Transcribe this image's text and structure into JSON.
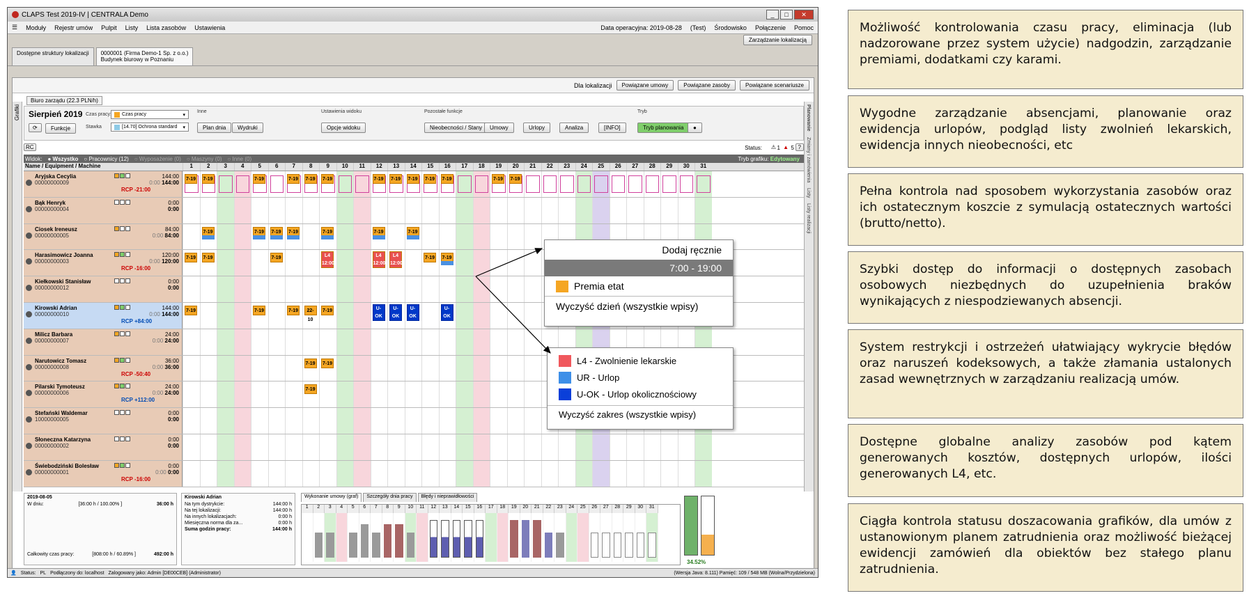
{
  "window": {
    "title": "CLAPS Test 2019-IV | CENTRALA Demo",
    "controls": [
      "_",
      "□",
      "✕"
    ]
  },
  "menu": {
    "items": [
      "Moduły",
      "Rejestr umów",
      "Pulpit",
      "Listy",
      "Lista zasobów",
      "Ustawienia"
    ],
    "date_label": "Data operacyjna: 2019-08-28",
    "env": "(Test)",
    "env2": "Środowisko",
    "conn": "Połączenie",
    "help": "Pomoc"
  },
  "tab_strip": {
    "label": "Zarządzanie lokalizacją"
  },
  "tabs": {
    "t1": "Dostępne struktury lokalizacji",
    "t2a": "0000001 (Firma Demo-1 Sp. z o.o.)",
    "t2b": "Budynek biurowy w Poznaniu"
  },
  "loc_bar": {
    "label": "Dla lokalizacji",
    "b1": "Powiązane umowy",
    "b2": "Powiązane zasoby",
    "b3": "Powiązane scenariusze"
  },
  "side": {
    "left": "Grafiki",
    "right1": "Planowanie",
    "right2": "Zmiany i zamówienia",
    "right3": "Listy",
    "right4": "Listy realizacji"
  },
  "subtab": "Biuro zarządu (22.3 PLN/h)",
  "tools": {
    "month": "Sierpień 2019",
    "czas_label": "Czas pracy:",
    "czas_value": "Czas pracy",
    "stawka_label": "Stawka",
    "stawka_value": "[14.70] Ochrona standard",
    "funkcje": "Funkcje",
    "inne": "Inne",
    "plan_dnia": "Plan dnia",
    "wydruki": "Wydruki",
    "ust_widoku": "Ustawienia widoku",
    "opcje_widoku": "Opcje widoku",
    "pozostale": "Pozostałe funkcje",
    "nieobecnosci": "Nieobecności / Stany",
    "umowy": "Umowy",
    "urlopy": "Urlopy",
    "analiza": "Analiza",
    "info": "[INFO]",
    "tryb": "Tryb",
    "tryb_btn": "Tryb planowania"
  },
  "status": {
    "label": "Status:",
    "warn_count": "1",
    "err_count": "5",
    "help": "?",
    "rc": "RC"
  },
  "view": {
    "label": "Widok:",
    "opts": [
      "Wszystko",
      "Pracownicy (12)",
      "Wyposażenie (0)",
      "Maszyny (0)",
      "Inne (0)"
    ],
    "mode": "Tryb grafiku:",
    "mode_val": "Edytowany"
  },
  "grid": {
    "col_header": "Name / Equipment / Machine",
    "days": [
      "1",
      "2",
      "3",
      "4",
      "5",
      "6",
      "7",
      "8",
      "9",
      "10",
      "11",
      "12",
      "13",
      "14",
      "15",
      "16",
      "17",
      "18",
      "19",
      "20",
      "21",
      "22",
      "23",
      "24",
      "25",
      "26",
      "27",
      "28",
      "29",
      "30",
      "31"
    ],
    "rows": [
      {
        "name": "Aryjska Cecylia",
        "id": "00000000009",
        "h1": "144:00",
        "h2g": "0:00",
        "h2": "144:00",
        "rcp": "RCP -21:00",
        "rcp_pos": false
      },
      {
        "name": "Bąk Henryk",
        "id": "00000000004",
        "h1": "0:00",
        "h2g": "",
        "h2": "0:00",
        "rcp": "",
        "rcp_pos": false
      },
      {
        "name": "Ciosek Ireneusz",
        "id": "00000000005",
        "h1": "84:00",
        "h2g": "0:00",
        "h2": "84:00",
        "rcp": "",
        "rcp_pos": false
      },
      {
        "name": "Harasimowicz Joanna",
        "id": "00000000003",
        "h1": "120:00",
        "h2g": "0:00",
        "h2": "120:00",
        "rcp": "RCP -16:00",
        "rcp_pos": false
      },
      {
        "name": "Kiełkowski Stanisław",
        "id": "00000000012",
        "h1": "0:00",
        "h2g": "",
        "h2": "0:00",
        "rcp": "",
        "rcp_pos": false
      },
      {
        "name": "Kirowski Adrian",
        "id": "00000000010",
        "h1": "144:00",
        "h2g": "0:00",
        "h2": "144:00",
        "rcp": "RCP +84:00",
        "rcp_pos": true
      },
      {
        "name": "Milicz Barbara",
        "id": "00000000007",
        "h1": "24:00",
        "h2g": "0:00",
        "h2": "24:00",
        "rcp": "",
        "rcp_pos": false
      },
      {
        "name": "Narutowicz Tomasz",
        "id": "00000000008",
        "h1": "36:00",
        "h2g": "0:00",
        "h2": "36:00",
        "rcp": "RCP -50:40",
        "rcp_pos": false
      },
      {
        "name": "Pilarski Tymoteusz",
        "id": "00000000006",
        "h1": "24:00",
        "h2g": "0:00",
        "h2": "24:00",
        "rcp": "RCP +112:00",
        "rcp_pos": true
      },
      {
        "name": "Stefański Waldemar",
        "id": "10000000005",
        "h1": "0:00",
        "h2g": "",
        "h2": "0:00",
        "rcp": "",
        "rcp_pos": false
      },
      {
        "name": "Słoneczna Katarzyna",
        "id": "00000000002",
        "h1": "0:00",
        "h2g": "",
        "h2": "0:00",
        "rcp": "",
        "rcp_pos": false
      },
      {
        "name": "Świebodziński Bolesław",
        "id": "00000000001",
        "h1": "0:00",
        "h2g": "0:00",
        "h2": "0:00",
        "rcp": "RCP -16:00",
        "rcp_pos": false
      }
    ],
    "shift_label": "7-19",
    "shift_label_2": "22-10",
    "l4_label": "L4",
    "l4_time": "12:00",
    "uok_label": "U-OK",
    "uok_time": "12:00"
  },
  "bottom": {
    "date": "2019-08-05",
    "w_dniu_label": "W dniu:",
    "w_dniu_val": "[36:00 h / 100.00% ]",
    "w_dniu_h": "36:00 h",
    "calk_label": "Całkowity czas pracy:",
    "calk_val": "[808:00 h / 60.89% ]",
    "calk_h": "492:00 h",
    "person": "Kirowski Adrian",
    "kv": [
      [
        "Na tym dystrykcie:",
        "144:00 h"
      ],
      [
        "Na tej lokalizacji:",
        "144:00 h"
      ],
      [
        "Na innych lokalizacjach:",
        "0:00 h"
      ],
      [
        "Miesięczna norma dla za...",
        "0:00 h"
      ],
      [
        "Suma godzin pracy:",
        "144:00 h"
      ]
    ],
    "tabs": [
      "Wykonanie umowy (graf)",
      "Szczegóły dnia pracy",
      "Błędy i nieprawidłowości"
    ],
    "percent": "34.52%",
    "fill_fraction": 0.3452
  },
  "statusbar": {
    "status": "Status:",
    "lang": "PL",
    "conn": "Podłączony do: localhost",
    "user": "Zalogowany jako: Admin [DE00CEB] (Administrator)",
    "right": "(Wersja Java: 8.111) Pamięć: 109 / 548 MB (Wolna/Przydzielona)"
  },
  "popup1": {
    "add": "Dodaj ręcznie",
    "time": "7:00 - 19:00",
    "premia": "Premia etat",
    "clear": "Wyczyść dzień (wszystkie wpisy)"
  },
  "popup2": {
    "items": [
      {
        "label": "L4 - Zwolnienie lekarskie",
        "color": "#f0585d"
      },
      {
        "label": "UR - Urlop",
        "color": "#3d8fe8"
      },
      {
        "label": "U-OK - Urlop okolicznościowy",
        "color": "#0a3fd9"
      }
    ],
    "clear": "Wyczyść zakres (wszystkie wpisy)"
  },
  "annotations": [
    "Możliwość kontrolowania czasu pracy, eliminacja (lub nadzorowane przez system użycie) nadgodzin, zarządzanie premiami, dodatkami czy karami.",
    "Wygodne zarządzanie absencjami, planowanie oraz ewidencja urlopów, podgląd listy zwolnień lekarskich, ewidencja innych nieobecności, etc",
    "Pełna kontrola nad sposobem wykorzystania zasobów oraz ich ostatecznym koszcie z symulacją ostatecznych wartości (brutto/netto).",
    "Szybki dostęp do informacji o dostępnych zasobach osobowych niezbędnych do uzupełnienia braków wynikających z niespodziewanych absencji.",
    "System restrykcji i ostrzeżeń ułatwiający wykrycie błędów oraz naruszeń kodeksowych, a także złamania ustalonych zasad wewnętrznych w zarządzaniu realizacją umów.",
    "Dostępne globalne analizy zasobów pod kątem generowanych kosztów, dostępnych urlopów, ilości generowanych L4, etc.",
    "Ciągła kontrola statusu doszacowania grafików, dla umów z ustanowionym planem zatrudnienia oraz możliwość bieżącej ewidencji zamówień dla obiektów bez stałego planu zatrudnienia."
  ]
}
